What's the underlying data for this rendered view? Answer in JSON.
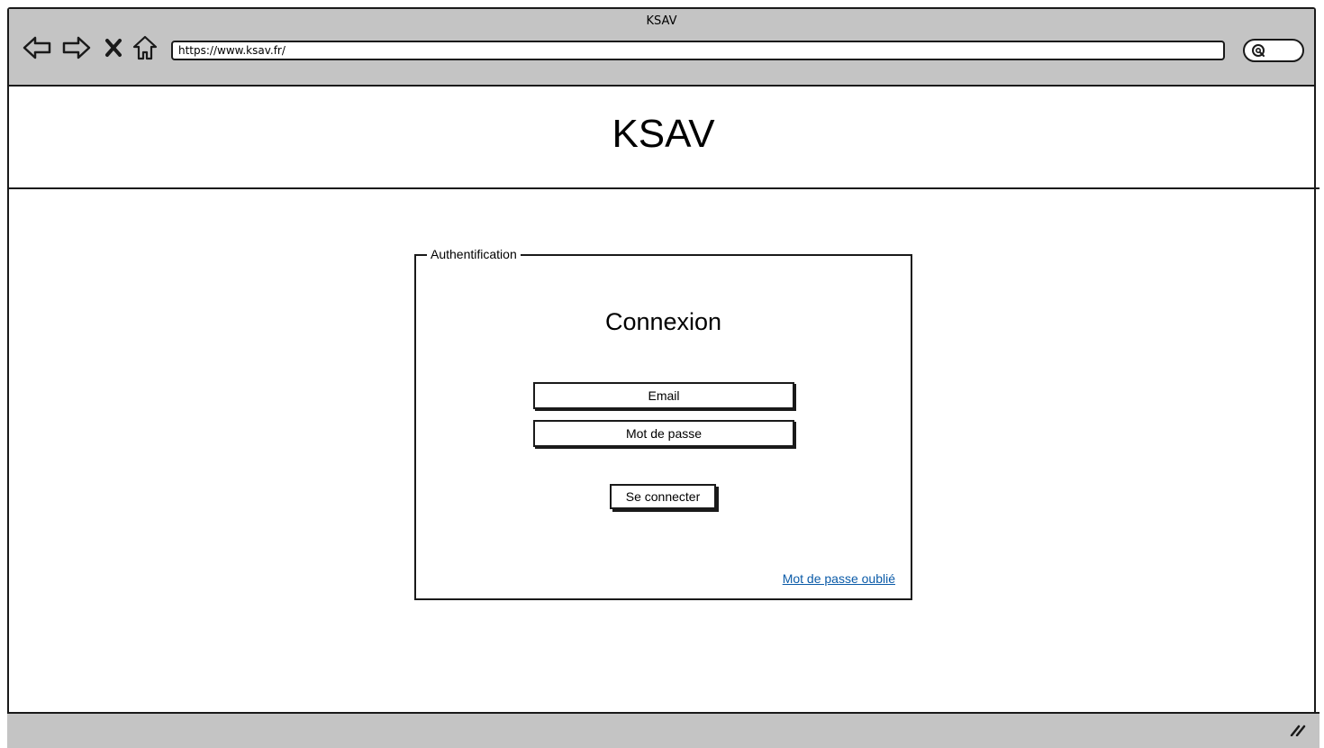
{
  "browser": {
    "window_title": "KSAV",
    "url": "https://www.ksav.fr/",
    "icons": [
      "back-arrow-icon",
      "forward-arrow-icon",
      "close-icon",
      "home-icon",
      "search-icon",
      "resize-grip-icon"
    ]
  },
  "header": {
    "site_title": "KSAV"
  },
  "auth": {
    "legend": "Authentification",
    "title": "Connexion",
    "email_placeholder": "Email",
    "password_placeholder": "Mot de passe",
    "submit_label": "Se connecter",
    "forgot_link": "Mot de passe oublié"
  },
  "colors": {
    "chrome": "#c4c4c4",
    "link": "#0b5ba8",
    "border": "#1a1a1a"
  }
}
